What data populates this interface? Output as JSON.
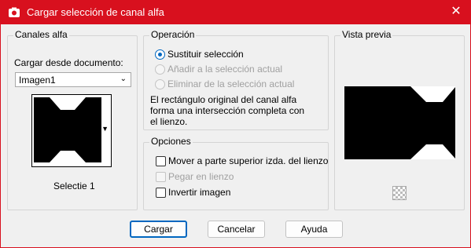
{
  "window": {
    "title": "Cargar selección de canal alfa"
  },
  "canales": {
    "legend": "Canales alfa",
    "load_label": "Cargar desde documento:",
    "document_value": "Imagen1",
    "channel_name": "Selectie 1"
  },
  "operacion": {
    "legend": "Operación",
    "options": [
      "Sustituir selección",
      "Añadir a la selección actual",
      "Eliminar de la selección actual"
    ],
    "note_lines": [
      "El rectángulo original del canal alfa",
      "forma una intersección completa con",
      "el lienzo."
    ]
  },
  "opciones": {
    "legend": "Opciones",
    "items": [
      "Mover a parte superior izda. del lienzo",
      "Pegar en lienzo",
      "Invertir imagen"
    ]
  },
  "vista": {
    "legend": "Vista previa"
  },
  "buttons": {
    "ok": "Cargar",
    "cancel": "Cancelar",
    "help": "Ayuda"
  },
  "colors": {
    "titlebar": "#d8101e",
    "accent": "#0067c0"
  }
}
